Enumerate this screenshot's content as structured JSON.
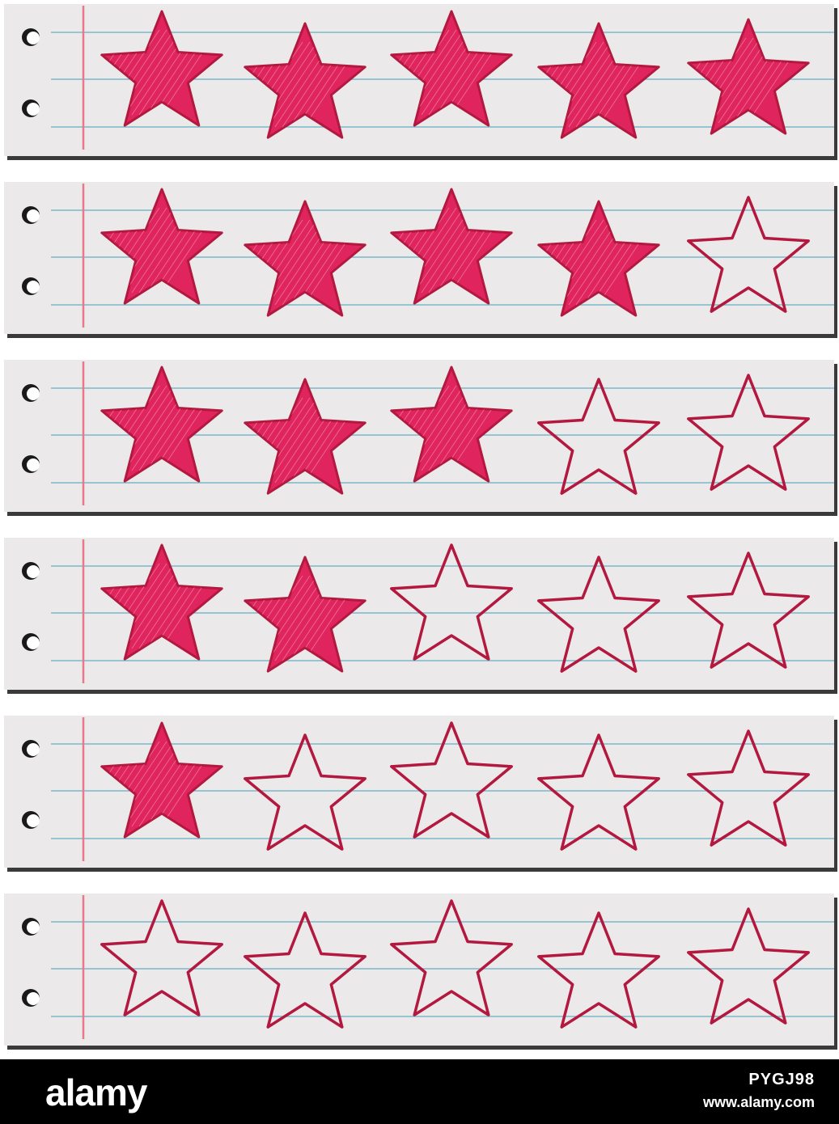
{
  "rows": [
    {
      "filled": 5,
      "total": 5
    },
    {
      "filled": 4,
      "total": 5
    },
    {
      "filled": 3,
      "total": 5
    },
    {
      "filled": 2,
      "total": 5
    },
    {
      "filled": 1,
      "total": 5
    },
    {
      "filled": 0,
      "total": 5
    }
  ],
  "colors": {
    "star_fill": "#e0245e",
    "star_outline": "#b3183f",
    "paper": "#ebe9ea",
    "rule_line": "#7ab8c8",
    "margin_line": "#e8788c"
  },
  "icons": {
    "filled": "star-filled-icon",
    "empty": "star-outline-icon"
  },
  "footer": {
    "logo": "alamy",
    "image_id": "PYGJ98",
    "url": "www.alamy.com"
  }
}
